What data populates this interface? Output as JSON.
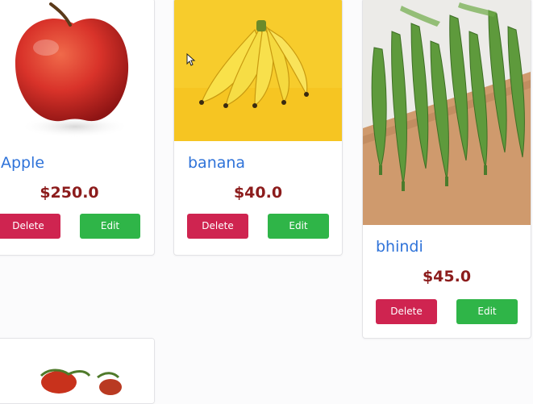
{
  "products": [
    {
      "name": "Apple",
      "price": "$250.0",
      "delete_label": "Delete",
      "edit_label": "Edit"
    },
    {
      "name": "banana",
      "price": "$40.0",
      "delete_label": "Delete",
      "edit_label": "Edit"
    },
    {
      "name": "bhindi",
      "price": "$45.0",
      "delete_label": "Delete",
      "edit_label": "Edit"
    },
    {
      "name": "",
      "price": ""
    }
  ],
  "colors": {
    "product_name": "#2f73d9",
    "price": "#8c1c1c",
    "delete_button": "#cf2450",
    "edit_button": "#2fb548"
  },
  "icons": [
    "apple-image",
    "banana-image",
    "okra-image",
    "tomato-image",
    "mouse-cursor-icon"
  ]
}
